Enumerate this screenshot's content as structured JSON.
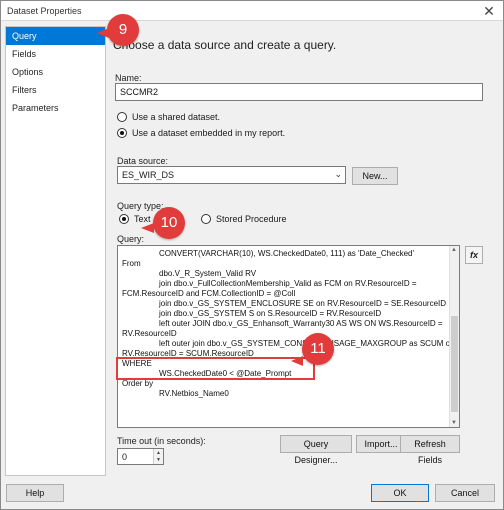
{
  "window": {
    "title": "Dataset Properties",
    "close_glyph": "✕"
  },
  "nav": {
    "items": [
      {
        "label": "Query",
        "active": true
      },
      {
        "label": "Fields"
      },
      {
        "label": "Options"
      },
      {
        "label": "Filters"
      },
      {
        "label": "Parameters"
      }
    ]
  },
  "main": {
    "heading": "Choose a data source and create a query.",
    "name_label": "Name:",
    "name_value": "SCCMR2",
    "radio_shared": "Use a shared dataset.",
    "radio_embedded": "Use a dataset embedded in my report.",
    "datasource_label": "Data source:",
    "datasource_value": "ES_WIR_DS",
    "new_button": "New...",
    "query_type_label": "Query type:",
    "radio_text": "Text",
    "radio_stored_procedure": "Stored Procedure",
    "query_label": "Query:",
    "fx_button": "fx",
    "query_lines": [
      "CONVERT(VARCHAR(10), WS.CheckedDate0, 111) as 'Date_Checked'",
      "From",
      "dbo.V_R_System_Valid RV",
      "join dbo.v_FullCollectionMembership_Valid as FCM on RV.ResourceID =",
      "FCM.ResourceID and FCM.CollectionID = @Coll",
      "join dbo.v_GS_SYSTEM_ENCLOSURE SE on RV.ResourceID = SE.ResourceID",
      "join dbo.v_GS_SYSTEM S on S.ResourceID = RV.ResourceID",
      "left outer JOIN dbo.v_GS_Enhansoft_Warranty30 AS WS ON WS.ResourceID =",
      "RV.ResourceID",
      "left outer join dbo.v_GS_SYSTEM_CONSOLE_USAGE_MAXGROUP as SCUM on",
      "RV.ResourceID = SCUM.ResourceID",
      "WHERE",
      "WS.CheckedDate0 < @Date_Prompt",
      "Order by",
      "RV.Netbios_Name0"
    ],
    "query_designer_button": "Query Designer...",
    "import_button": "Import...",
    "refresh_fields_button": "Refresh Fields",
    "timeout_label": "Time out (in seconds):",
    "timeout_value": "0"
  },
  "footer": {
    "help": "Help",
    "ok": "OK",
    "cancel": "Cancel"
  },
  "callouts": [
    "9",
    "10",
    "11"
  ],
  "colors": {
    "accent": "#0078d7",
    "callout": "#e23b3b"
  }
}
